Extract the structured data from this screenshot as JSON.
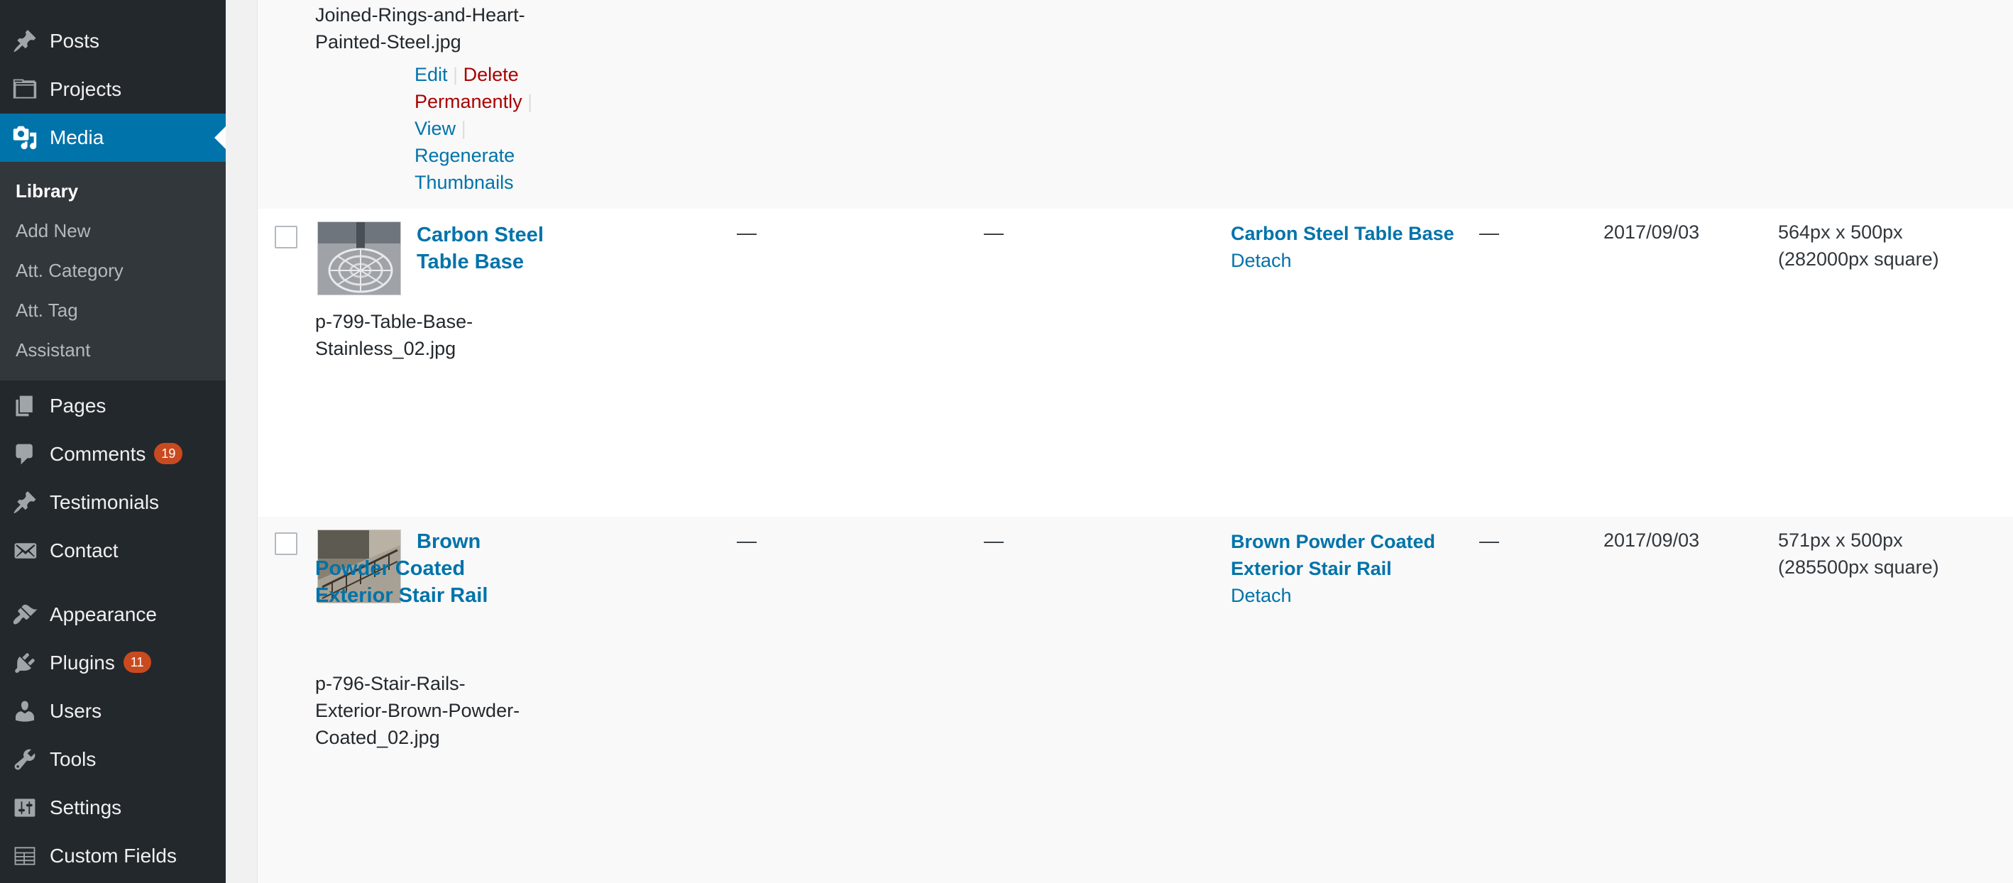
{
  "sidebar": {
    "items": [
      {
        "label": "Posts",
        "icon": "pin-icon"
      },
      {
        "label": "Projects",
        "icon": "folder-icon"
      },
      {
        "label": "Media",
        "icon": "media-icon",
        "active": true
      },
      {
        "label": "Pages",
        "icon": "pages-icon"
      },
      {
        "label": "Comments",
        "icon": "comment-icon",
        "badge": "19"
      },
      {
        "label": "Testimonials",
        "icon": "pin-icon"
      },
      {
        "label": "Contact",
        "icon": "mail-icon"
      },
      {
        "label": "Appearance",
        "icon": "brush-icon"
      },
      {
        "label": "Plugins",
        "icon": "plugin-icon",
        "badge": "11"
      },
      {
        "label": "Users",
        "icon": "user-icon"
      },
      {
        "label": "Tools",
        "icon": "wrench-icon"
      },
      {
        "label": "Settings",
        "icon": "settings-icon"
      },
      {
        "label": "Custom Fields",
        "icon": "fields-icon"
      }
    ],
    "submenu": [
      "Library",
      "Add New",
      "Att. Category",
      "Att. Tag",
      "Assistant"
    ]
  },
  "rows": [
    {
      "filename": "Joined-Rings-and-Heart-Painted-Steel.jpg",
      "actions": {
        "edit": "Edit",
        "delete": "Delete Permanently",
        "view": "View",
        "regenerate": "Regenerate Thumbnails"
      }
    },
    {
      "title": "Carbon Steel Table Base",
      "filename": "p-799-Table-Base-Stainless_02.jpg",
      "author": "—",
      "categories": "—",
      "attached_to": "Carbon Steel Table Base",
      "detach": "Detach",
      "comments": "—",
      "date": "2017/09/03",
      "dimensions": "564px x 500px",
      "area": "(282000px square)"
    },
    {
      "title": "Brown Powder Coated Exterior Stair Rail",
      "filename": "p-796-Stair-Rails-Exterior-Brown-Powder-Coated_02.jpg",
      "author": "—",
      "categories": "—",
      "attached_to": "Brown Powder Coated Exterior Stair Rail",
      "detach": "Detach",
      "comments": "—",
      "date": "2017/09/03",
      "dimensions": "571px x 500px",
      "area": "(285500px square)"
    }
  ],
  "colors": {
    "sidebar": "#23282d",
    "submenu": "#32373c",
    "accent": "#0073aa",
    "delete": "#aa0000",
    "badge": "#ca4a1f"
  }
}
